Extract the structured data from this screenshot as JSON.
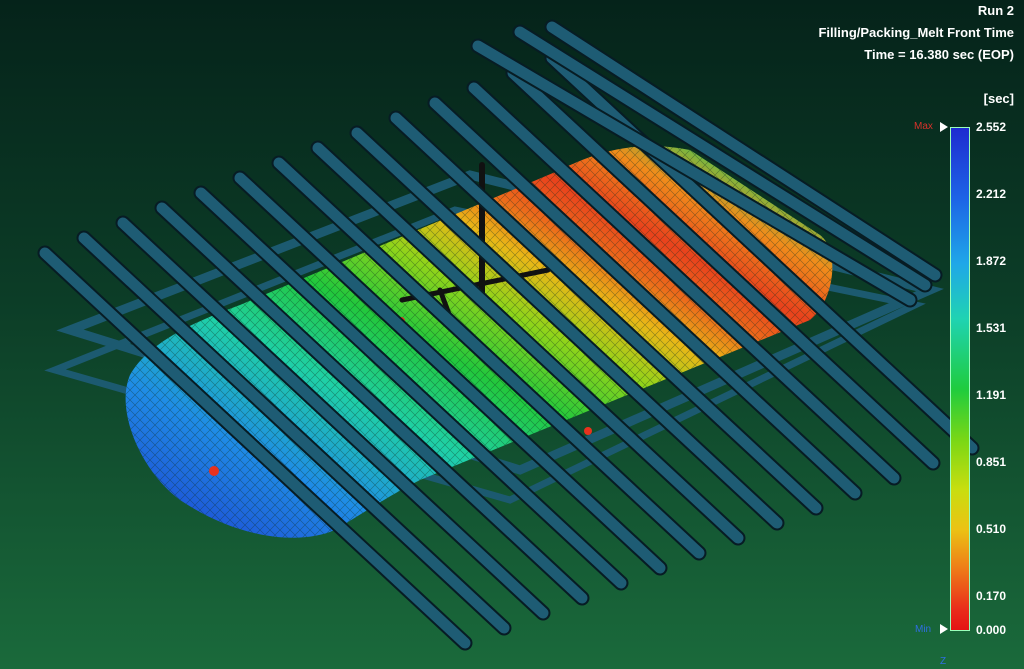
{
  "header": {
    "run": "Run 2",
    "result": "Filling/Packing_Melt Front Time",
    "time": "Time = 16.380 sec (EOP)"
  },
  "legend": {
    "unit": "[sec]",
    "max_label": "Max",
    "min_label": "Min",
    "values": [
      "2.552",
      "2.212",
      "1.872",
      "1.531",
      "1.191",
      "0.851",
      "0.510",
      "0.170",
      "0.000"
    ],
    "colors": {
      "max": "#1e2bd0",
      "mid": "#1fcc3e",
      "min": "#e41414",
      "max_marker": "#d9322b",
      "min_marker": "#2f6ee0"
    }
  },
  "axis": {
    "z_label": "Z"
  },
  "model": {
    "mesh_color": "#1e5c74",
    "background_top": "#05231a",
    "background_bottom": "#1a6a3b"
  }
}
